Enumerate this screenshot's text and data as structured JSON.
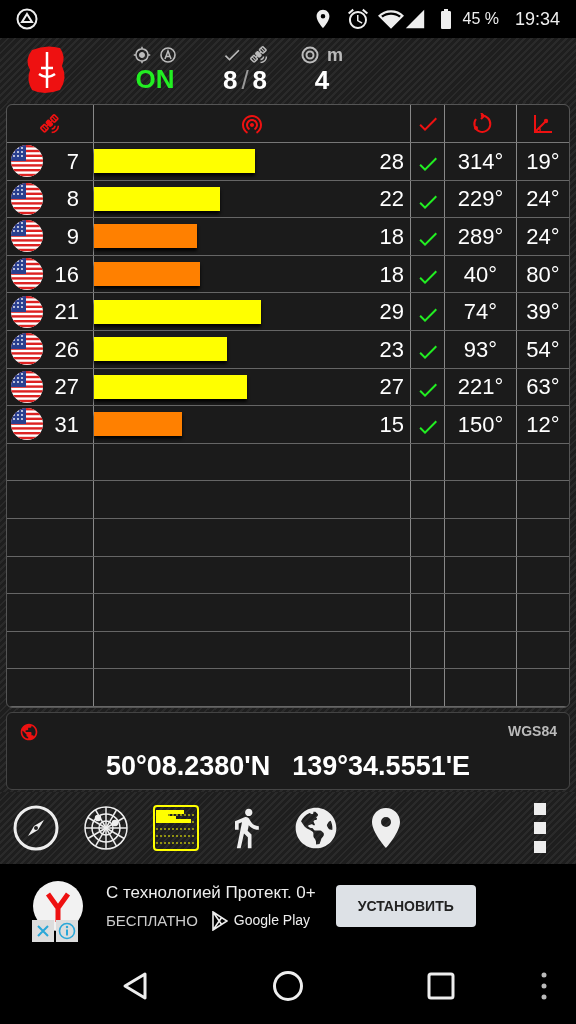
{
  "status_bar": {
    "battery": "45 %",
    "time": "19:34"
  },
  "header": {
    "fix_status": "ON",
    "used": "8",
    "separator": "/",
    "in_view": "8",
    "accuracy_unit": "m",
    "accuracy": "4"
  },
  "satellites": [
    {
      "prn": "7",
      "snr": "28",
      "level": 0.51,
      "color": "#ffff00",
      "used": true,
      "azimuth": "314°",
      "elevation": "19°"
    },
    {
      "prn": "8",
      "snr": "22",
      "level": 0.4,
      "color": "#ffff00",
      "used": true,
      "azimuth": "229°",
      "elevation": "24°"
    },
    {
      "prn": "9",
      "snr": "18",
      "level": 0.325,
      "color": "#ff8000",
      "used": true,
      "azimuth": "289°",
      "elevation": "24°"
    },
    {
      "prn": "16",
      "snr": "18",
      "level": 0.335,
      "color": "#ff8000",
      "used": true,
      "azimuth": "40°",
      "elevation": "80°"
    },
    {
      "prn": "21",
      "snr": "29",
      "level": 0.53,
      "color": "#ffff00",
      "used": true,
      "azimuth": "74°",
      "elevation": "39°"
    },
    {
      "prn": "26",
      "snr": "23",
      "level": 0.42,
      "color": "#ffff00",
      "used": true,
      "azimuth": "93°",
      "elevation": "54°"
    },
    {
      "prn": "27",
      "snr": "27",
      "level": 0.485,
      "color": "#ffff00",
      "used": true,
      "azimuth": "221°",
      "elevation": "63°"
    },
    {
      "prn": "31",
      "snr": "15",
      "level": 0.28,
      "color": "#ff8000",
      "used": true,
      "azimuth": "150°",
      "elevation": "12°"
    }
  ],
  "location": {
    "datum": "WGS84",
    "latitude": "50°08.2380'N",
    "longitude": "139°34.5551'E"
  },
  "toolbar": [
    {
      "kind": "compass",
      "selected": false
    },
    {
      "kind": "radar",
      "selected": false
    },
    {
      "kind": "signal",
      "selected": true
    },
    {
      "kind": "walk",
      "selected": false
    },
    {
      "kind": "globe",
      "selected": false
    },
    {
      "kind": "pin",
      "selected": false
    }
  ],
  "ad": {
    "title": "С технологией Протект. 0+",
    "price": "БЕСПЛАТНО",
    "store": "Google Play",
    "button": "УСТАНОВИТЬ"
  }
}
